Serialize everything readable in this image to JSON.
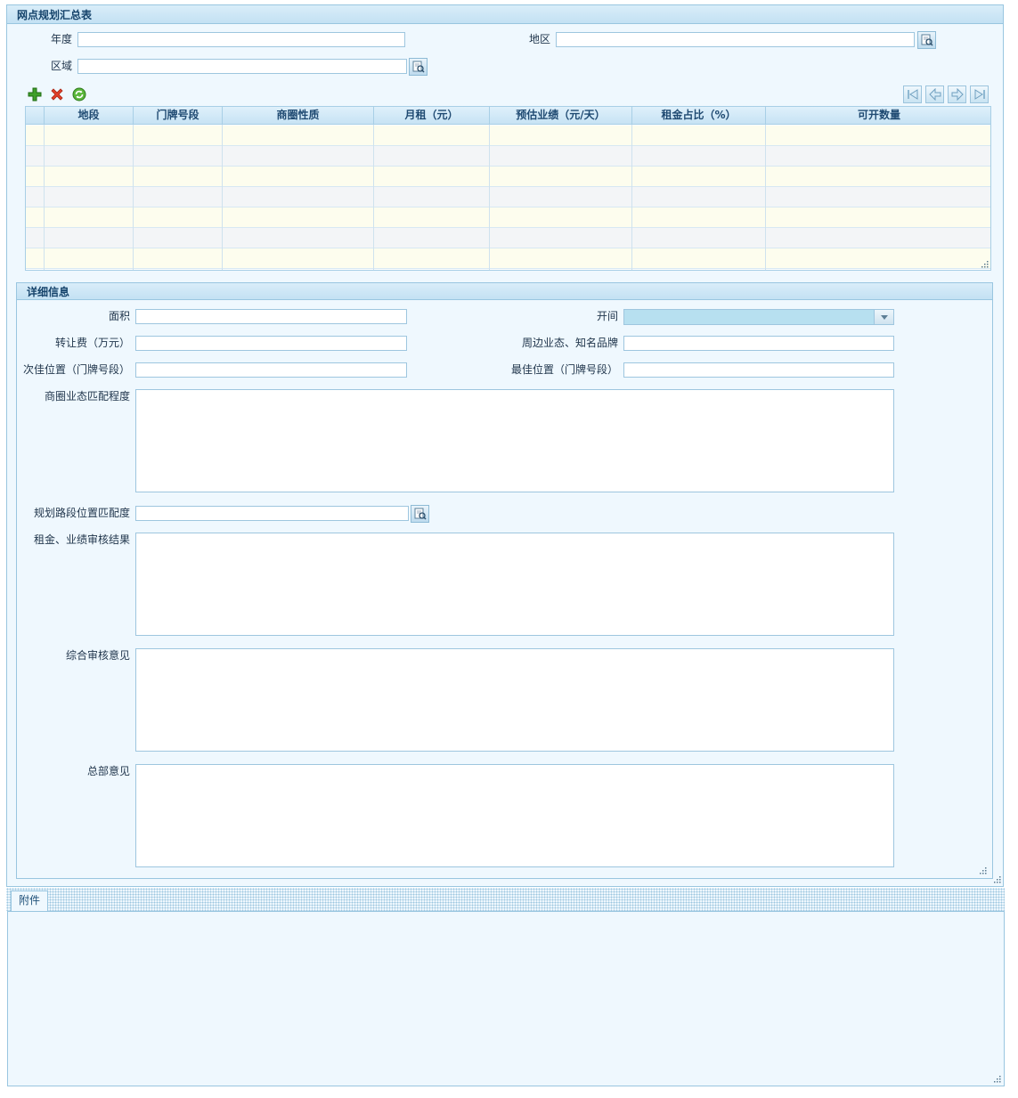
{
  "summary_panel": {
    "title": "网点规划汇总表",
    "fields": {
      "year_label": "年度",
      "region_label": "地区",
      "area_label": "区域"
    }
  },
  "grid": {
    "columns": [
      "地段",
      "门牌号段",
      "商圈性质",
      "月租（元）",
      "预估业绩（元/天）",
      "租金占比（%）",
      "可开数量"
    ]
  },
  "detail_panel": {
    "title": "详细信息",
    "area_label": "面积",
    "bays_label": "开间",
    "transfer_fee_label": "转让费（万元）",
    "nearby_brands_label": "周边业态、知名品牌",
    "second_best_label": "次佳位置（门牌号段）",
    "best_label": "最佳位置（门牌号段）",
    "match_label": "商圈业态匹配程度",
    "plan_match_label": "规划路段位置匹配度",
    "rent_review_label": "租金、业绩审核结果",
    "overall_opinion_label": "综合审核意见",
    "hq_opinion_label": "总部意见"
  },
  "attachment": {
    "tab_label": "附件"
  }
}
